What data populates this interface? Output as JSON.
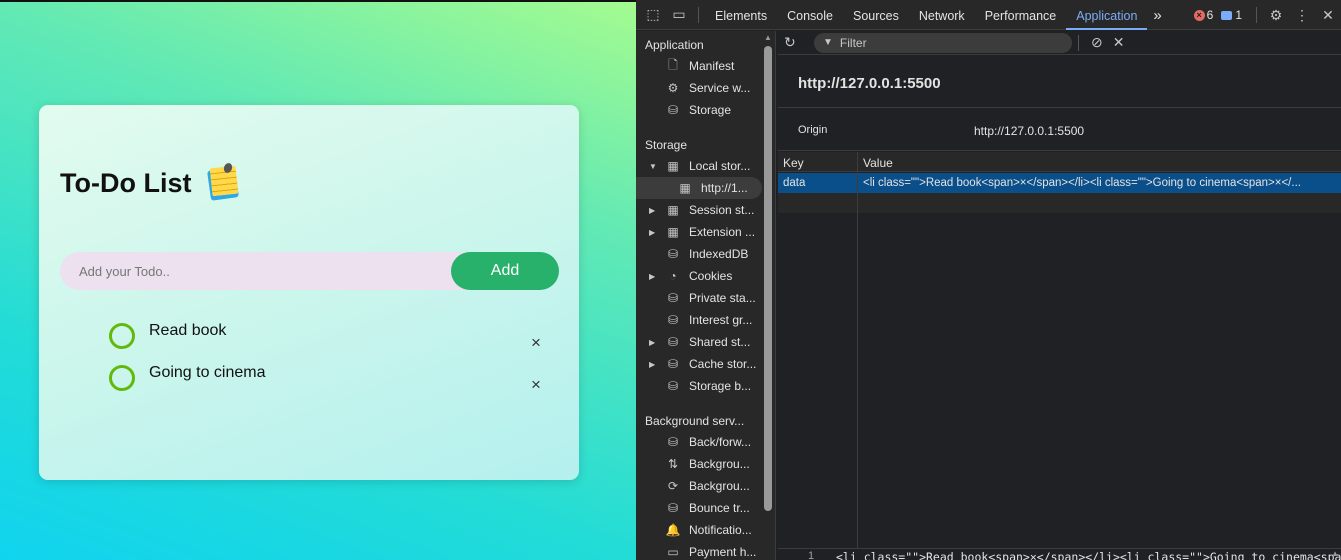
{
  "app": {
    "title": "To-Do List",
    "input_placeholder": "Add your Todo..",
    "add_label": "Add",
    "items": [
      {
        "text": "Read book"
      },
      {
        "text": "Going to cinema"
      }
    ],
    "close_glyph": "×",
    "colors": {
      "add_button": "#28b16b",
      "check_ring": "#63b90b"
    }
  },
  "devtools": {
    "tabs": [
      "Elements",
      "Console",
      "Sources",
      "Network",
      "Performance",
      "Application"
    ],
    "active_tab": "Application",
    "more_tabs": "»",
    "error_count": "6",
    "message_count": "1",
    "sidebar": {
      "application_heading": "Application",
      "application_items": [
        {
          "label": "Manifest",
          "icon": "file-icon"
        },
        {
          "label": "Service w...",
          "icon": "gears-icon"
        },
        {
          "label": "Storage",
          "icon": "database-icon"
        }
      ],
      "storage_heading": "Storage",
      "storage_items": [
        {
          "label": "Local stor...",
          "icon": "table-icon",
          "expanded": true
        },
        {
          "label": "http://1...",
          "icon": "table-icon",
          "selected": true
        },
        {
          "label": "Session st...",
          "icon": "table-icon"
        },
        {
          "label": "Extension ...",
          "icon": "table-icon"
        },
        {
          "label": "IndexedDB",
          "icon": "database-icon"
        },
        {
          "label": "Cookies",
          "icon": "cookie-icon"
        },
        {
          "label": "Private sta...",
          "icon": "database-icon"
        },
        {
          "label": "Interest gr...",
          "icon": "database-icon"
        },
        {
          "label": "Shared st...",
          "icon": "database-icon"
        },
        {
          "label": "Cache stor...",
          "icon": "database-icon"
        },
        {
          "label": "Storage b...",
          "icon": "database-icon"
        }
      ],
      "background_heading": "Background serv...",
      "background_items": [
        {
          "label": "Back/forw...",
          "icon": "database-icon"
        },
        {
          "label": "Backgrou...",
          "icon": "arrows-updown-icon"
        },
        {
          "label": "Backgrou...",
          "icon": "sync-icon"
        },
        {
          "label": "Bounce tr...",
          "icon": "database-icon"
        },
        {
          "label": "Notificatio...",
          "icon": "bell-icon"
        },
        {
          "label": "Payment h...",
          "icon": "card-icon"
        }
      ]
    },
    "toolbar": {
      "filter_placeholder": "Filter"
    },
    "origin": {
      "title": "http://127.0.0.1:5500",
      "label": "Origin",
      "value": "http://127.0.0.1:5500"
    },
    "table": {
      "columns": [
        "Key",
        "Value"
      ],
      "rows": [
        {
          "key": "data",
          "value": "<li class=\"\">Read book<span>×</span></li><li class=\"\">Going to cinema<span>×</..."
        }
      ]
    },
    "preview": {
      "line_number": "1",
      "text": "<li class=\"\">Read book<span>×</span></li><li class=\"\">Going to cinema<span>×</span></li>"
    }
  }
}
